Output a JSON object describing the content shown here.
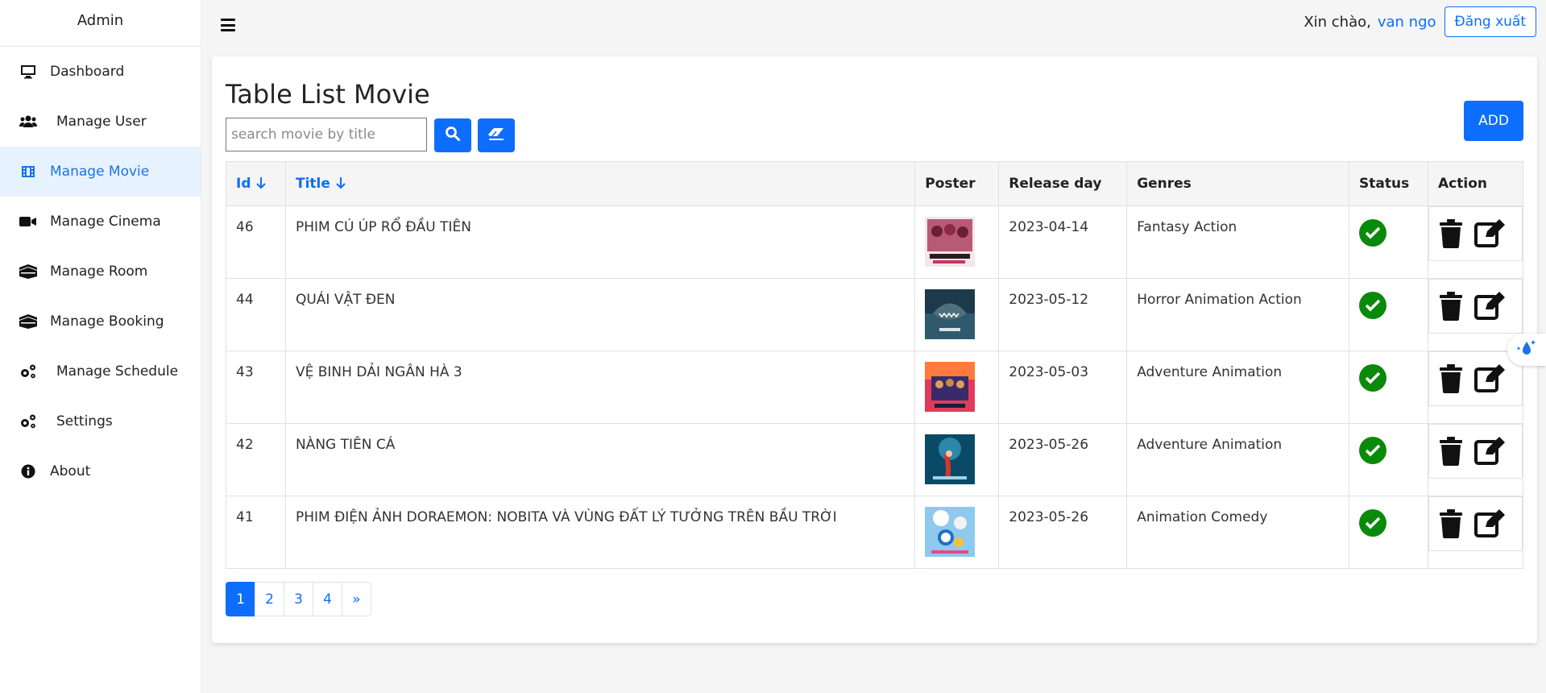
{
  "sidebar": {
    "brand": "Admin",
    "items": [
      {
        "label": "Dashboard",
        "icon": "monitor-icon"
      },
      {
        "label": "Manage User",
        "icon": "users-icon"
      },
      {
        "label": "Manage Movie",
        "icon": "film-icon",
        "active": true
      },
      {
        "label": "Manage Cinema",
        "icon": "video-camera-icon"
      },
      {
        "label": "Manage Room",
        "icon": "room-icon"
      },
      {
        "label": "Manage Booking",
        "icon": "booking-icon"
      },
      {
        "label": "Manage Schedule",
        "icon": "gears-icon"
      },
      {
        "label": "Settings",
        "icon": "gears-icon"
      },
      {
        "label": "About",
        "icon": "info-icon"
      }
    ]
  },
  "header": {
    "greeting": "Xin chào,",
    "username": "van ngo",
    "logout_label": "Đăng xuất"
  },
  "main": {
    "title": "Table List Movie",
    "search_placeholder": "search movie by title",
    "add_label": "ADD",
    "columns": [
      "Id",
      "Title",
      "Poster",
      "Release day",
      "Genres",
      "Status",
      "Action"
    ],
    "rows": [
      {
        "id": "46",
        "title": "PHIM CÚ ÚP RỔ ĐẦU TIÊN",
        "release": "2023-04-14",
        "genres": "Fantasy Action",
        "status": "active"
      },
      {
        "id": "44",
        "title": "QUÁI VẬT ĐEN",
        "release": "2023-05-12",
        "genres": "Horror Animation Action",
        "status": "active"
      },
      {
        "id": "43",
        "title": "VỆ BINH DẢI NGÂN HÀ 3",
        "release": "2023-05-03",
        "genres": "Adventure Animation",
        "status": "active"
      },
      {
        "id": "42",
        "title": "NÀNG TIÊN CÁ",
        "release": "2023-05-26",
        "genres": "Adventure Animation",
        "status": "active"
      },
      {
        "id": "41",
        "title": "PHIM ĐIỆN ẢNH DORAEMON: NOBITA VÀ VÙNG ĐẤT LÝ TƯỞNG TRÊN BẦU TRỜI",
        "release": "2023-05-26",
        "genres": "Animation Comedy",
        "status": "active"
      }
    ],
    "pagination": [
      "1",
      "2",
      "3",
      "4",
      "»"
    ]
  },
  "colors": {
    "accent": "#0d6efd",
    "status_ok": "#0a8a0a",
    "active_nav_bg": "#e7f2ff"
  }
}
